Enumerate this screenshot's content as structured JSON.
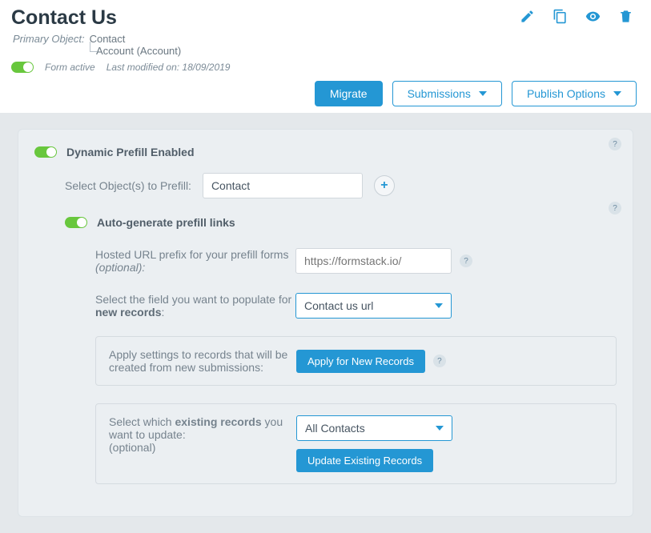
{
  "header": {
    "title": "Contact Us"
  },
  "primary": {
    "label": "Primary Object:",
    "value": "Contact",
    "child": "Account (Account)"
  },
  "status": {
    "active_label": "Form active",
    "modified_label": "Last modified on: 18/09/2019"
  },
  "buttons": {
    "migrate": "Migrate",
    "submissions": "Submissions",
    "publish": "Publish Options"
  },
  "panel": {
    "dynamic_label": "Dynamic Prefill Enabled",
    "select_objects_label": "Select Object(s) to Prefill:",
    "select_objects_value": "Contact",
    "autogen_label": "Auto-generate prefill links",
    "hosted_url_label": "Hosted URL prefix for your prefill forms",
    "optional": "(optional)",
    "hosted_url_placeholder": "https://formstack.io/",
    "field_new_label_a": "Select the field you want to populate for ",
    "field_new_label_b": "new records",
    "field_new_value": "Contact us url",
    "apply_settings_label": "Apply settings to records that will be created from new submissions:",
    "apply_new_btn": "Apply for New Records",
    "existing_label_a": "Select which ",
    "existing_label_b": "existing records",
    "existing_label_c": " you want to update:",
    "existing_value": "All Contacts",
    "update_btn": "Update Existing Records"
  }
}
